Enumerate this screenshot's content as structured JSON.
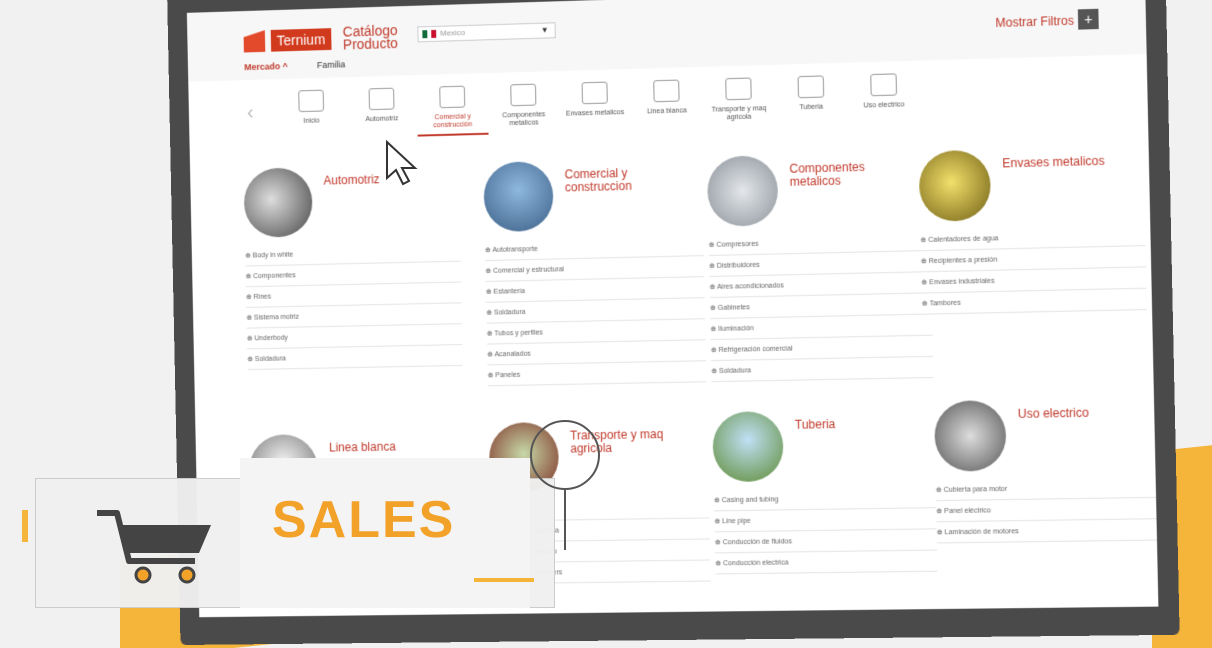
{
  "header": {
    "brand": "Ternium",
    "catalog_line1": "Catálogo",
    "catalog_line2": "Producto",
    "country": "Mexico",
    "show_filters": "Mostrar Filtros",
    "plus": "+"
  },
  "tabs": [
    {
      "label": "Mercado ^",
      "active": true
    },
    {
      "label": "Familia",
      "active": false
    }
  ],
  "nav": [
    {
      "label": "Inicio"
    },
    {
      "label": "Automotriz"
    },
    {
      "label": "Comercial y construcción",
      "active": true
    },
    {
      "label": "Componentes metalicos"
    },
    {
      "label": "Envases metalicos"
    },
    {
      "label": "Linea blanca"
    },
    {
      "label": "Transporte y maq agricola"
    },
    {
      "label": "Tuberia"
    },
    {
      "label": "Uso electrico"
    }
  ],
  "cards": [
    {
      "title": "Automotriz",
      "color": "#888",
      "items": [
        "Body in white",
        "Componentes",
        "Rines",
        "Sistema motriz",
        "Underbody",
        "Soldadura"
      ]
    },
    {
      "title": "Comercial y construccion",
      "color": "#3b79b6",
      "items": [
        "Autotransporte",
        "Comercial y estructural",
        "Estantería",
        "Soldadura",
        "Tubos y perfiles",
        "Acanalados",
        "Paneles"
      ]
    },
    {
      "title": "Componentes metalicos",
      "color": "#b9c0c6",
      "items": [
        "Compresores",
        "Distribuidores",
        "Aires acondicionados",
        "Gabinetes",
        "Iluminación",
        "Refrigeración comercial",
        "Soldadura"
      ]
    },
    {
      "title": "Envases metalicos",
      "color": "#c9b43a",
      "items": [
        "Calentadores de agua",
        "Recipientes a presión",
        "Envases industriales",
        "Tambores"
      ]
    },
    {
      "title": "Linea blanca",
      "color": "#aaa",
      "items": []
    },
    {
      "title": "Transporte y maq agricola",
      "color": "#9a3a2c",
      "items": [
        "",
        "Maquinaria agricola",
        "Transporte pesado",
        "Truck long members"
      ]
    },
    {
      "title": "Tuberia",
      "color": "#7fa3c7",
      "items": [
        "Casing and tubing",
        "Line pipe",
        "Conducción de fluidos",
        "Conducción electrica"
      ]
    },
    {
      "title": "Uso electrico",
      "color": "#777",
      "items": [
        "Cubierta para motor",
        "Panel eléctrico",
        "Laminación de motores"
      ]
    }
  ],
  "banner": {
    "text": "SALES"
  },
  "icons": [
    "cart-icon",
    "cursor-icon",
    "magnifier-icon",
    "plus-icon"
  ]
}
